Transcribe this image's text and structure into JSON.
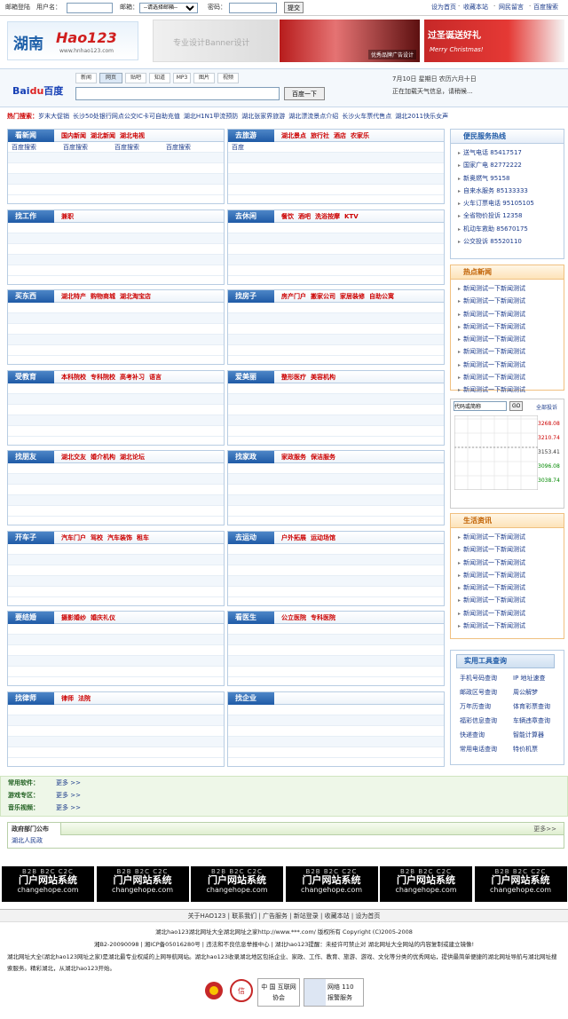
{
  "topbar": {
    "mail_login": "邮箱登陆",
    "username_label": "用户名：",
    "mailbox_label": "邮箱：",
    "mailbox_select": "--请选择邮箱--",
    "password_label": "密码：",
    "submit": "提交",
    "set_home": "设为首页",
    "bookmark": "收藏本站",
    "guestbook": "网民留言",
    "baidu_search": "百度搜索"
  },
  "header": {
    "logo_province": "湖南",
    "logo_brand": "Hao123",
    "logo_url": "www.hnhao123.com",
    "ad1_text": "专业设计Banner设计",
    "ad2_text": "优秀品牌广告设计",
    "ad3_title": "过圣诞送好礼",
    "ad3_sub": "Merry Christmas!"
  },
  "search": {
    "tabs": [
      "新闻",
      "网页",
      "贴吧",
      "知道",
      "MP3",
      "图片",
      "视频"
    ],
    "active_tab": "网页",
    "button": "百度一下",
    "date": "7月10日  星期日  农历六月十日",
    "weather": "正在加载天气信息，请稍候..."
  },
  "hot": {
    "label": "热门搜索：",
    "items": [
      "岁末大促销",
      "长沙50处银行网点公交IC卡可自助充值",
      "湖北H1N1甲流预防",
      "湖北张家界旅游",
      "湖北漂流景点介绍",
      "长沙火车票代售点",
      "湖北2011快乐女声"
    ]
  },
  "categories": [
    {
      "title": "看新闻",
      "links": [
        "国内新闻",
        "湖北新闻",
        "湖北电视"
      ],
      "rows": [
        [
          "百度搜索",
          "百度搜索",
          "百度搜索",
          "百度搜索"
        ]
      ]
    },
    {
      "title": "去旅游",
      "links": [
        "湖北景点",
        "旅行社",
        "酒店",
        "农家乐"
      ],
      "rows": [
        [
          "百度"
        ]
      ]
    },
    {
      "title": "找工作",
      "links": [
        "兼职"
      ],
      "rows": []
    },
    {
      "title": "去休闲",
      "links": [
        "餐饮",
        "酒吧",
        "洗浴按摩",
        "KTV"
      ],
      "rows": []
    },
    {
      "title": "买东西",
      "links": [
        "湖北特产",
        "购物商城",
        "湖北淘宝店"
      ],
      "rows": []
    },
    {
      "title": "找房子",
      "links": [
        "房产门户",
        "搬家公司",
        "家居装修",
        "自助公寓"
      ],
      "rows": []
    },
    {
      "title": "受教育",
      "links": [
        "本科院校",
        "专科院校",
        "高考补习",
        "语言"
      ],
      "rows": []
    },
    {
      "title": "爱美丽",
      "links": [
        "整形医疗",
        "美容机构"
      ],
      "rows": []
    },
    {
      "title": "找朋友",
      "links": [
        "湖北交友",
        "婚介机构",
        "湖北论坛"
      ],
      "rows": []
    },
    {
      "title": "找家政",
      "links": [
        "家政服务",
        "保洁服务"
      ],
      "rows": []
    },
    {
      "title": "开车子",
      "links": [
        "汽车门户",
        "驾校",
        "汽车装饰",
        "租车"
      ],
      "rows": []
    },
    {
      "title": "去运动",
      "links": [
        "户外拓展",
        "运动场馆"
      ],
      "rows": []
    },
    {
      "title": "要结婚",
      "links": [
        "摄影婚纱",
        "婚庆礼仪"
      ],
      "rows": []
    },
    {
      "title": "看医生",
      "links": [
        "公立医院",
        "专科医院"
      ],
      "rows": []
    },
    {
      "title": "找律师",
      "links": [
        "律师",
        "法院"
      ],
      "rows": []
    },
    {
      "title": "找企业",
      "links": [],
      "rows": []
    }
  ],
  "hotline": {
    "title": "便民服务热线",
    "items": [
      "送气电话 85417517",
      "国家广电 82772222",
      "新奥燃气 95158",
      "自来水服务 85133333",
      "火车订票电话 95105105",
      "全省物价投诉 12358",
      "机动车救助 85670175",
      "公交投诉 85520110"
    ]
  },
  "hotnews": {
    "title": "热点新闻",
    "items": [
      "新闻测试一下新闻测试",
      "新闻测试一下新闻测试",
      "新闻测试一下新闻测试",
      "新闻测试一下新闻测试",
      "新闻测试一下新闻测试",
      "新闻测试一下新闻测试",
      "新闻测试一下新闻测试",
      "新闻测试一下新闻测试",
      "新闻测试一下新闻测试"
    ]
  },
  "stock": {
    "input_value": "代码或简称",
    "go": "GO",
    "complaint": "全部投诉",
    "prices": [
      "3268.08",
      "3210.74",
      "3153.41",
      "3096.08",
      "3038.74"
    ]
  },
  "life": {
    "title": "生活资讯",
    "items": [
      "新闻测试一下新闻测试",
      "新闻测试一下新闻测试",
      "新闻测试一下新闻测试",
      "新闻测试一下新闻测试",
      "新闻测试一下新闻测试",
      "新闻测试一下新闻测试",
      "新闻测试一下新闻测试",
      "新闻测试一下新闻测试"
    ]
  },
  "tools": {
    "title": "实用工具查询",
    "items": [
      "手机号码查询",
      "IP 地址速查",
      "邮政区号查询",
      "周公解梦",
      "万年历查询",
      "体育彩票查询",
      "福彩信息查询",
      "车辆违章查询",
      "快递查询",
      "智能计算器",
      "常用电话查询",
      "特价机票"
    ]
  },
  "soft": {
    "rows": [
      {
        "label": "常用软件：",
        "more": "更多 >>"
      },
      {
        "label": "游戏专区：",
        "more": "更多 >>"
      },
      {
        "label": "音乐视频：",
        "more": "更多 >>"
      }
    ]
  },
  "gov": {
    "title": "政府部门公布",
    "more": "更多>>",
    "link": "湖北人民政"
  },
  "banners": {
    "top": "B2B B2C C2C",
    "main": "门户网站系统",
    "site": "changehope.com"
  },
  "footer": {
    "nav": [
      "关于HAO123",
      "联系我们",
      "广告服务",
      "新站登录",
      "收藏本站",
      "设为首页"
    ],
    "line1": "湖北hao123湖北网址大全湖北网址之家http://www.***.com/ 版权所有 Copyright (C)2005-2008",
    "line2": "湘B2-20090098  |  湘ICP备05016280号  |  违法和不良信息举报中心  |  湖北hao123提醒：未经许可禁止对 湖北网址大全网站的内容复制或建立镜像!",
    "line3": "湖北网址大全(湖北hao123网址之家)是湖北最专业权威的上网导航网站。湖北hao123收录湖北地区包括企业、家政、工作、教育、旅游、游戏、文化等分类的优秀网站，提供最简单便捷的湖北网址导航与湖北网址搜索服务。精彩湖北，从湖北hao123开始。",
    "badge1": "中 国 互联网协会",
    "badge2": "网络 110 报警服务"
  }
}
